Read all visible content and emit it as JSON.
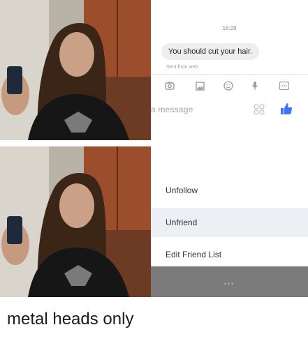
{
  "chat": {
    "time": "16:28",
    "message": "You should cut your hair.",
    "sent_from": "Sent from web",
    "placeholder": "a message",
    "toolbar_icons": [
      "camera-icon",
      "image-icon",
      "emoji-icon",
      "microphone-icon",
      "more-icon"
    ],
    "like_color": "#3b73ff"
  },
  "menu": {
    "items": [
      "Unfollow",
      "Unfriend",
      "Edit Friend List"
    ],
    "highlighted_index": 1,
    "dots": "•••"
  },
  "caption": "metal heads only"
}
